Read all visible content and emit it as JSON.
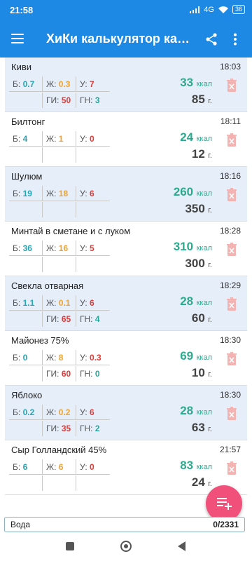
{
  "status": {
    "time": "21:58",
    "network": "4G",
    "battery": "36"
  },
  "appbar": {
    "title": "ХиКи калькулятор калорий"
  },
  "labels": {
    "b": "Б:",
    "z": "Ж:",
    "u": "У:",
    "gi": "ГИ:",
    "gn": "ГН:",
    "kcal_unit": "ккал",
    "gram_unit": "г."
  },
  "entries": [
    {
      "name": "Киви",
      "time": "18:03",
      "b": "0.7",
      "z": "0.3",
      "u": "7",
      "gi": "50",
      "gn": "3",
      "kcal": "33",
      "grams": "85"
    },
    {
      "name": "Билтонг",
      "time": "18:11",
      "b": "4",
      "z": "1",
      "u": "0",
      "gi": "",
      "gn": "",
      "kcal": "24",
      "grams": "12"
    },
    {
      "name": "Шулюм",
      "time": "18:16",
      "b": "19",
      "z": "18",
      "u": "6",
      "gi": "",
      "gn": "",
      "kcal": "260",
      "grams": "350"
    },
    {
      "name": "Минтай в сметане и с луком",
      "time": "18:28",
      "b": "36",
      "z": "16",
      "u": "5",
      "gi": "",
      "gn": "",
      "kcal": "310",
      "grams": "300"
    },
    {
      "name": "Свекла отварная",
      "time": "18:29",
      "b": "1.1",
      "z": "0.1",
      "u": "6",
      "gi": "65",
      "gn": "4",
      "kcal": "28",
      "grams": "60"
    },
    {
      "name": "Майонез 75%",
      "time": "18:30",
      "b": "0",
      "z": "8",
      "u": "0.3",
      "gi": "60",
      "gn": "0",
      "kcal": "69",
      "grams": "10"
    },
    {
      "name": "Яблоко",
      "time": "18:30",
      "b": "0.2",
      "z": "0.2",
      "u": "6",
      "gi": "35",
      "gn": "2",
      "kcal": "28",
      "grams": "63"
    },
    {
      "name": "Сыр Голландский 45%",
      "time": "21:57",
      "b": "6",
      "z": "6",
      "u": "0",
      "gi": "",
      "gn": "",
      "kcal": "83",
      "grams": "24"
    }
  ],
  "water": {
    "label": "Вода",
    "value": "0/2331"
  },
  "colors": {
    "primary": "#1e88e5",
    "fab": "#f0507a",
    "kcal": "#2aab8e",
    "protein": "#26a6b5",
    "fat": "#f2a22b",
    "carbs": "#e53935",
    "row_alt": "#e6eef9"
  },
  "icons": {
    "menu": "hamburger-icon",
    "share": "share-icon",
    "more": "more-vert-icon",
    "delete": "trash-icon",
    "fab": "playlist-add-icon"
  }
}
